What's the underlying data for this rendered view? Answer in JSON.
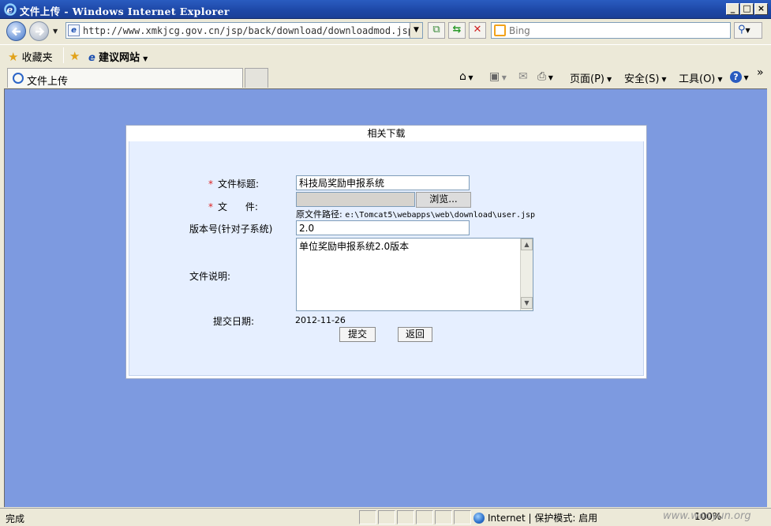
{
  "window": {
    "title": "文件上传 - Windows Internet Explorer",
    "minimize": "_",
    "maximize": "□",
    "close": "×"
  },
  "addressbar": {
    "url": "http://www.xmkjcg.gov.cn/jsp/back/download/downloadmod.jsp?",
    "search_placeholder": "Bing"
  },
  "favorites": {
    "favorites_label": "收藏夹",
    "suggested_sites_label": "建议网站"
  },
  "tab": {
    "label": "文件上传"
  },
  "commandbar": {
    "page_label": "页面(P)",
    "safety_label": "安全(S)",
    "tools_label": "工具(O)"
  },
  "form": {
    "title": "相关下载",
    "file_title_label": "文件标题:",
    "file_title_value": "科技局奖励申报系统",
    "file_label": "文      件:",
    "browse_label": "浏览...",
    "original_path_label": "原文件路径:",
    "original_path_value": "e:\\Tomcat5\\webapps\\web\\download\\user.jsp",
    "version_label": "版本号(针对子系统)",
    "version_value": "2.0",
    "description_label": "文件说明:",
    "description_value": "单位奖励申报系统2.0版本",
    "date_label": "提交日期:",
    "date_value": "2012-11-26",
    "submit_label": "提交",
    "back_label": "返回",
    "required_mark": "*"
  },
  "statusbar": {
    "status_text": "完成",
    "zone_text": "Internet | 保护模式: 启用",
    "zoom_text": "100%",
    "watermark": "www.wooyun.org"
  },
  "icons": [
    "ie-logo-icon",
    "back-arrow-icon",
    "forward-arrow-icon",
    "page-icon",
    "compat-view-icon",
    "refresh-icon",
    "stop-icon",
    "bing-icon",
    "search-icon",
    "star-icon",
    "add-favorite-icon",
    "home-icon",
    "feeds-icon",
    "mail-icon",
    "print-icon",
    "help-icon",
    "globe-icon"
  ],
  "colors": {
    "titlebar": "#1d47a6",
    "page_background": "#7d9ae0",
    "form_background": "#e6efff",
    "required": "#dd2222"
  }
}
